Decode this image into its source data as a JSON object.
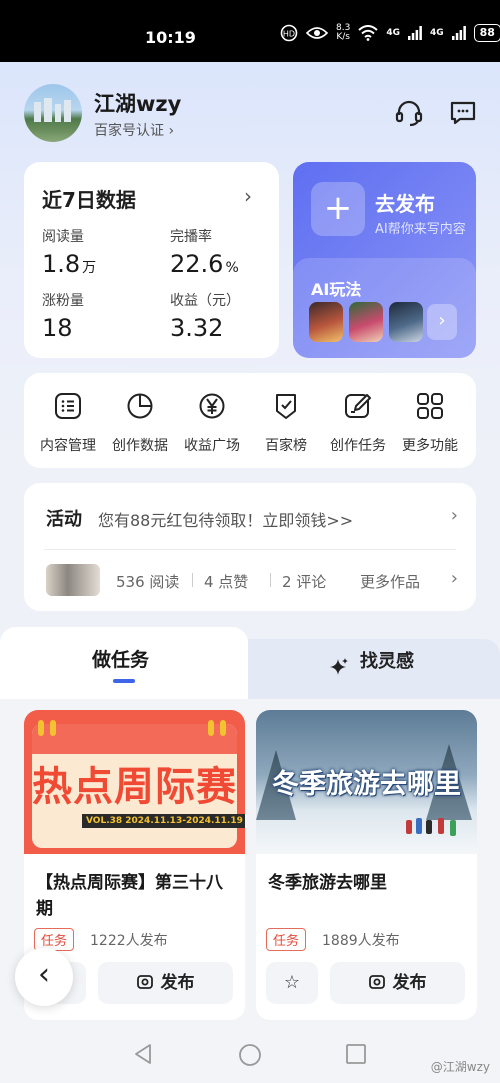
{
  "status_bar": {
    "time": "10:19",
    "net_speed_value": "8.3",
    "net_speed_unit": "K/s",
    "signal1": "4G",
    "signal2": "4G",
    "battery": "88"
  },
  "profile": {
    "name": "江湖wzy",
    "subtitle": "百家号认证",
    "subtitle_arrow": "›"
  },
  "data_card": {
    "title": "近7日数据",
    "arrow": "›",
    "stats": [
      {
        "label": "阅读量",
        "value": "1.8",
        "unit": "万"
      },
      {
        "label": "完播率",
        "value": "22.6",
        "unit": "%"
      },
      {
        "label": "涨粉量",
        "value": "18",
        "unit": ""
      },
      {
        "label": "收益（元）",
        "value": "3.32",
        "unit": ""
      }
    ]
  },
  "publish_card": {
    "plus": "+",
    "title": "去发布",
    "subtitle": "AI帮你来写内容",
    "ai_title": "AI玩法",
    "ai_next": "›"
  },
  "functions": [
    {
      "label": "内容管理",
      "icon": "list-icon"
    },
    {
      "label": "创作数据",
      "icon": "pie-chart-icon"
    },
    {
      "label": "收益广场",
      "icon": "yen-icon"
    },
    {
      "label": "百家榜",
      "icon": "badge-icon"
    },
    {
      "label": "创作任务",
      "icon": "edit-task-icon"
    },
    {
      "label": "更多功能",
      "icon": "grid-icon"
    }
  ],
  "activity": {
    "label": "活动",
    "text": "您有88元红包待领取！立即领钱>>",
    "reads": "536 阅读",
    "likes": "4 点赞",
    "comments": "2 评论",
    "more": "更多作品",
    "arrow": "›"
  },
  "tabs": {
    "active": "做任务",
    "inactive": "找灵感"
  },
  "tasks": [
    {
      "title": "【热点周际赛】第三十八期",
      "tag": "任务",
      "count": "1222人发布",
      "post": "发布",
      "banner": "热点周际赛",
      "banner_sub": "VOL.38 2024.11.13-2024.11.19"
    },
    {
      "title": "冬季旅游去哪里",
      "tag": "任务",
      "count": "1889人发布",
      "post": "发布",
      "banner": "冬季旅游去哪里"
    }
  ],
  "back_button": "‹",
  "watermark": "@江湖wzy"
}
